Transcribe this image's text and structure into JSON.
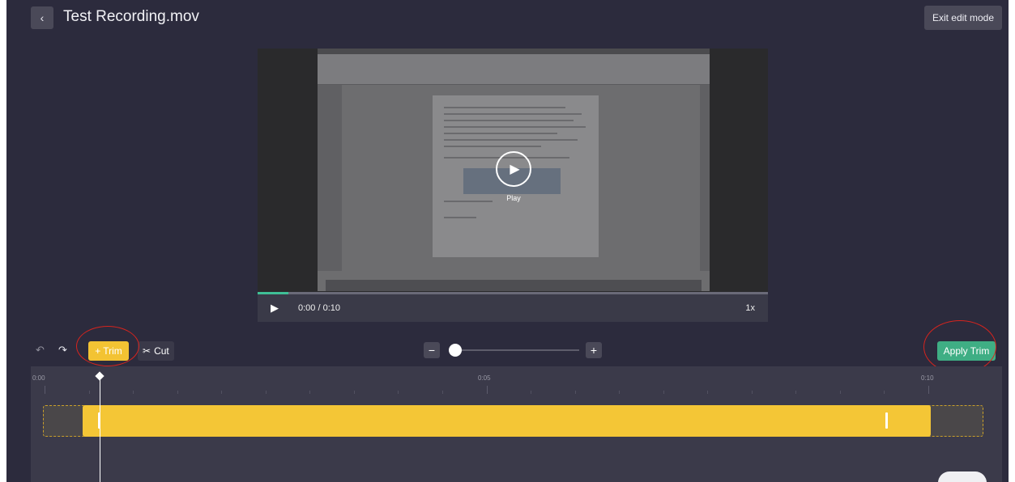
{
  "header": {
    "back_icon": "‹",
    "title": "Test Recording.mov",
    "exit_label": "Exit edit mode"
  },
  "player": {
    "overlay_label": "Play",
    "time": "0:00 / 0:10",
    "speed": "1x",
    "progress_fraction": 0.06
  },
  "toolbar": {
    "undo_icon": "undo-icon",
    "redo_icon": "redo-icon",
    "trim_label": "Trim",
    "cut_label": "Cut",
    "zoom_minus": "−",
    "zoom_plus": "+",
    "zoom_level": 0,
    "apply_label": "Apply Trim"
  },
  "timeline": {
    "ticks": [
      "0:00",
      "0:05",
      "0:10"
    ],
    "duration_seconds": 10,
    "trim_start_seconds": 0.45,
    "trim_end_seconds": 9.45,
    "playhead_seconds": 0.6
  },
  "colors": {
    "accent_trim": "#f3c333",
    "accent_apply": "#3fae84",
    "annotation_ring": "#d6241e"
  }
}
